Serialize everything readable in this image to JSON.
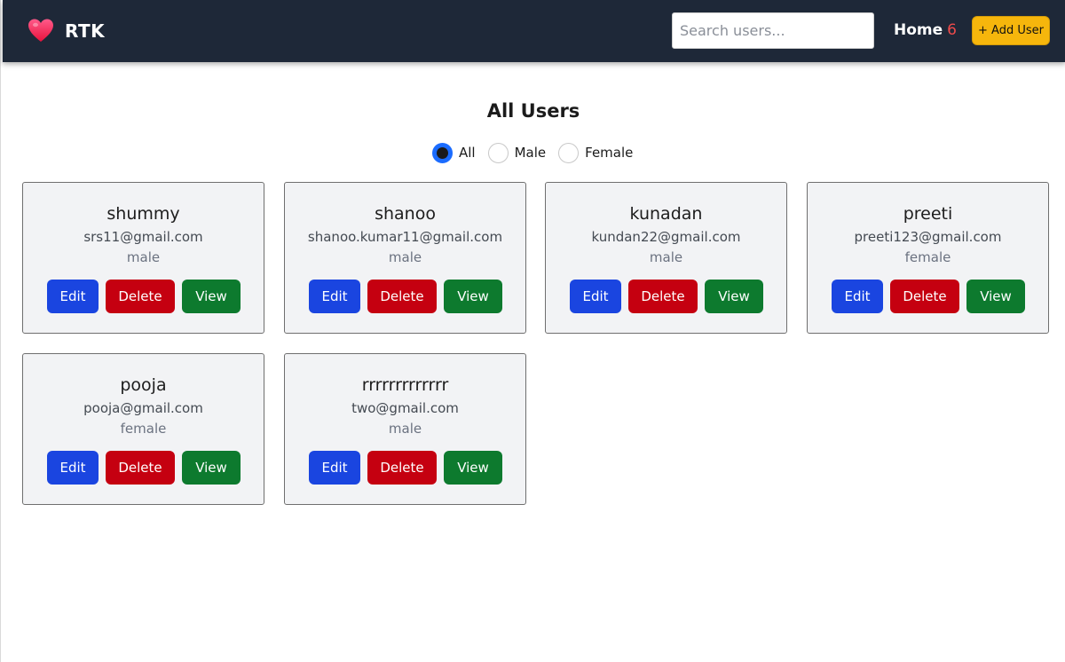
{
  "navbar": {
    "brand": "RTK",
    "brand_icon": "heart-icon",
    "search_placeholder": "Search users...",
    "search_value": "",
    "home_label": "Home",
    "home_count": "6",
    "add_user_label": "+ Add User",
    "colors": {
      "background": "#1e2838",
      "accent": "#f6b60c",
      "count": "#ef4b4b"
    }
  },
  "main": {
    "title": "All Users",
    "filter": {
      "selected": "All",
      "options": [
        {
          "label": "All"
        },
        {
          "label": "Male"
        },
        {
          "label": "Female"
        }
      ]
    },
    "actions": {
      "edit": "Edit",
      "delete": "Delete",
      "view": "View"
    },
    "action_colors": {
      "edit": "#1a45e0",
      "delete": "#c50010",
      "view": "#0d7a2e"
    },
    "users": [
      {
        "name": "shummy",
        "email": "srs11@gmail.com",
        "gender": "male"
      },
      {
        "name": "shanoo",
        "email": "shanoo.kumar11@gmail.com",
        "gender": "male"
      },
      {
        "name": "kunadan",
        "email": "kundan22@gmail.com",
        "gender": "male"
      },
      {
        "name": "preeti",
        "email": "preeti123@gmail.com",
        "gender": "female"
      },
      {
        "name": "pooja",
        "email": "pooja@gmail.com",
        "gender": "female"
      },
      {
        "name": "rrrrrrrrrrrrr",
        "email": "two@gmail.com",
        "gender": "male"
      }
    ]
  }
}
